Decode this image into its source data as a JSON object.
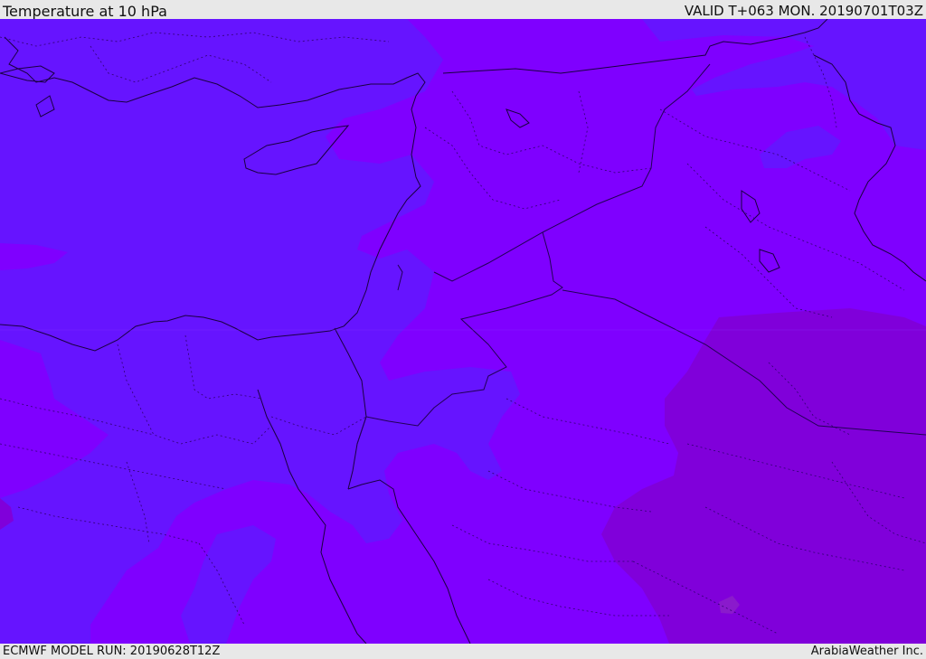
{
  "header": {
    "title": "Temperature at 10 hPa",
    "valid": "VALID T+063 MON. 20190701T03Z"
  },
  "footer": {
    "model_run": "ECMWF MODEL RUN: 20190628T12Z",
    "credit": "ArabiaWeather Inc."
  },
  "map": {
    "colors": {
      "field_base": "#7f00ff",
      "field_cooler": "#6614ff",
      "field_warmer": "#8000da",
      "field_warmest": "#8a1acc",
      "coastline": "#1a0040",
      "borders": "#2a0060"
    }
  }
}
